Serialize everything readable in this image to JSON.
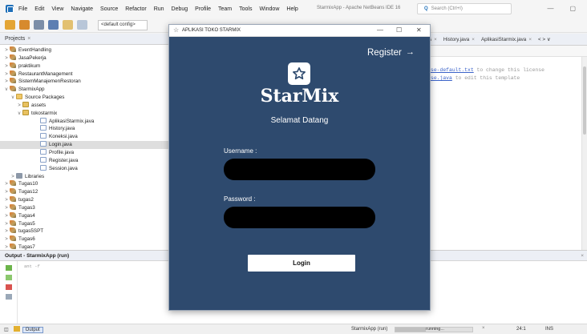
{
  "ide": {
    "menu": [
      "File",
      "Edit",
      "View",
      "Navigate",
      "Source",
      "Refactor",
      "Run",
      "Debug",
      "Profile",
      "Team",
      "Tools",
      "Window",
      "Help"
    ],
    "title": "StarmixApp - Apache NetBeans IDE 16",
    "search_placeholder": "Search (Ctrl+I)",
    "config": "<default config>",
    "window_controls": [
      "—",
      "▢"
    ]
  },
  "projects": {
    "tab_label": "Projects",
    "tab_close": "×",
    "tree": [
      {
        "label": "EventHandling",
        "icon": "project",
        "twisty": ">",
        "level": 0
      },
      {
        "label": "JasaPekerja",
        "icon": "project",
        "twisty": ">",
        "level": 0
      },
      {
        "label": "praktikum",
        "icon": "project",
        "twisty": ">",
        "level": 0
      },
      {
        "label": "RestaurantManagement",
        "icon": "project",
        "twisty": ">",
        "level": 0
      },
      {
        "label": "SistemManajemenRestoran",
        "icon": "project",
        "twisty": ">",
        "level": 0
      },
      {
        "label": "StarmixApp",
        "icon": "project",
        "twisty": "v",
        "level": 0
      },
      {
        "label": "Source Packages",
        "icon": "folder",
        "twisty": "v",
        "level": 1
      },
      {
        "label": "assets",
        "icon": "package",
        "twisty": ">",
        "level": 2
      },
      {
        "label": "tokostarmix",
        "icon": "package",
        "twisty": "v",
        "level": 2
      },
      {
        "label": "AplikasiStarmix.java",
        "icon": "java",
        "twisty": "",
        "level": 3
      },
      {
        "label": "History.java",
        "icon": "java",
        "twisty": "",
        "level": 3
      },
      {
        "label": "Koneksi.java",
        "icon": "java",
        "twisty": "",
        "level": 3
      },
      {
        "label": "Login.java",
        "icon": "java",
        "twisty": "",
        "level": 3,
        "selected": true
      },
      {
        "label": "Profile.java",
        "icon": "java",
        "twisty": "",
        "level": 3
      },
      {
        "label": "Register.java",
        "icon": "java",
        "twisty": "",
        "level": 3
      },
      {
        "label": "Session.java",
        "icon": "java",
        "twisty": "",
        "level": 3
      },
      {
        "label": "Libraries",
        "icon": "library",
        "twisty": ">",
        "level": 1
      },
      {
        "label": "Tugas10",
        "icon": "project",
        "twisty": ">",
        "level": 0
      },
      {
        "label": "Tugas12",
        "icon": "project",
        "twisty": ">",
        "level": 0
      },
      {
        "label": "tugas2",
        "icon": "project",
        "twisty": ">",
        "level": 0
      },
      {
        "label": "Tugas3",
        "icon": "project",
        "twisty": ">",
        "level": 0
      },
      {
        "label": "Tugas4",
        "icon": "project",
        "twisty": ">",
        "level": 0
      },
      {
        "label": "Tugas5",
        "icon": "project",
        "twisty": ">",
        "level": 0
      },
      {
        "label": "tugas5SPT",
        "icon": "project",
        "twisty": ">",
        "level": 0
      },
      {
        "label": "Tugas6",
        "icon": "project",
        "twisty": ">",
        "level": 0
      },
      {
        "label": "Tugas7",
        "icon": "project",
        "twisty": ">",
        "level": 0
      }
    ]
  },
  "editor": {
    "tabs": [
      {
        "label": "s",
        "close": "×"
      },
      {
        "label": "History.java",
        "close": "×"
      },
      {
        "label": "AplikasiStarmix.java",
        "close": "×"
      },
      {
        "label": "< > ∨",
        "close": ""
      }
    ],
    "line1_link": "se-default.txt",
    "line1_text": " to change this license",
    "line2_link": "se.java",
    "line2_text": " to edit this template"
  },
  "output": {
    "tab_label": "Output - StarmixApp (run)",
    "close": "×",
    "text": "ant -f"
  },
  "statusbar": {
    "output_label": "Output",
    "app": "StarmixApp (run)",
    "status": "running...",
    "close": "×",
    "position": "24:1",
    "mode": "INS"
  },
  "dialog": {
    "title": "APLIKASI TOKO STARMIX",
    "controls": [
      "—",
      "☐",
      "✕"
    ],
    "register_label": "Register",
    "register_arrow": "→",
    "brand": "StarMix",
    "welcome": "Selamat Datang",
    "username_label": "Username :",
    "username_value": "",
    "password_label": "Password :",
    "password_value": "",
    "login_label": "Login",
    "colors": {
      "background": "#2e4a6e",
      "input": "#000000",
      "button": "#ffffff"
    }
  }
}
